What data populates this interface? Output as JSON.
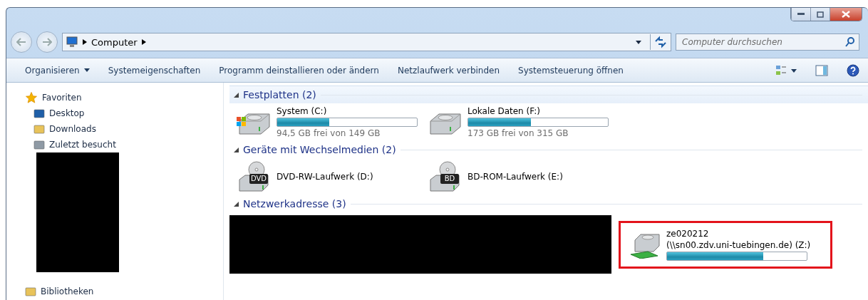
{
  "address_bar": {
    "crumbs": [
      "Computer"
    ]
  },
  "search": {
    "placeholder": "Computer durchsuchen"
  },
  "toolbar": {
    "items": [
      {
        "label": "Organisieren",
        "has_menu": true
      },
      {
        "label": "Systemeigenschaften"
      },
      {
        "label": "Programm deinstallieren oder ändern"
      },
      {
        "label": "Netzlaufwerk verbinden"
      },
      {
        "label": "Systemsteuerung öffnen"
      }
    ]
  },
  "sidebar": {
    "groups": [
      {
        "label": "Favoriten",
        "kind": "favorites",
        "redacted": true,
        "children": [
          {
            "label": "Desktop",
            "kind": "desktop"
          },
          {
            "label": "Downloads",
            "kind": "downloads"
          },
          {
            "label": "Zuletzt besucht",
            "kind": "recent"
          }
        ]
      },
      {
        "label": "Bibliotheken",
        "kind": "libraries"
      }
    ]
  },
  "sections": [
    {
      "title": "Festplatten (2)",
      "expanded": true,
      "items": [
        {
          "kind": "hdd",
          "system": true,
          "name": "System (C:)",
          "level": 0.37,
          "free": "94,5 GB frei von 149 GB"
        },
        {
          "kind": "hdd",
          "name": "Lokale Daten (F:)",
          "level": 0.45,
          "free": "173 GB frei von 315 GB"
        }
      ]
    },
    {
      "title": "Geräte mit Wechselmedien (2)",
      "expanded": true,
      "items": [
        {
          "kind": "optical",
          "badge": "DVD",
          "name": "DVD-RW-Laufwerk (D:)"
        },
        {
          "kind": "optical",
          "badge": "BD",
          "name": "BD-ROM-Laufwerk (E:)"
        }
      ]
    },
    {
      "title": "Netzwerkadresse (3)",
      "expanded": true,
      "redacted": true,
      "items": [
        {
          "kind": "network",
          "name": "ze020212",
          "path": "(\\\\sn00.zdv.uni-tuebingen.de) (Z:)",
          "level": 0.69,
          "highlighted": true
        }
      ]
    }
  ]
}
